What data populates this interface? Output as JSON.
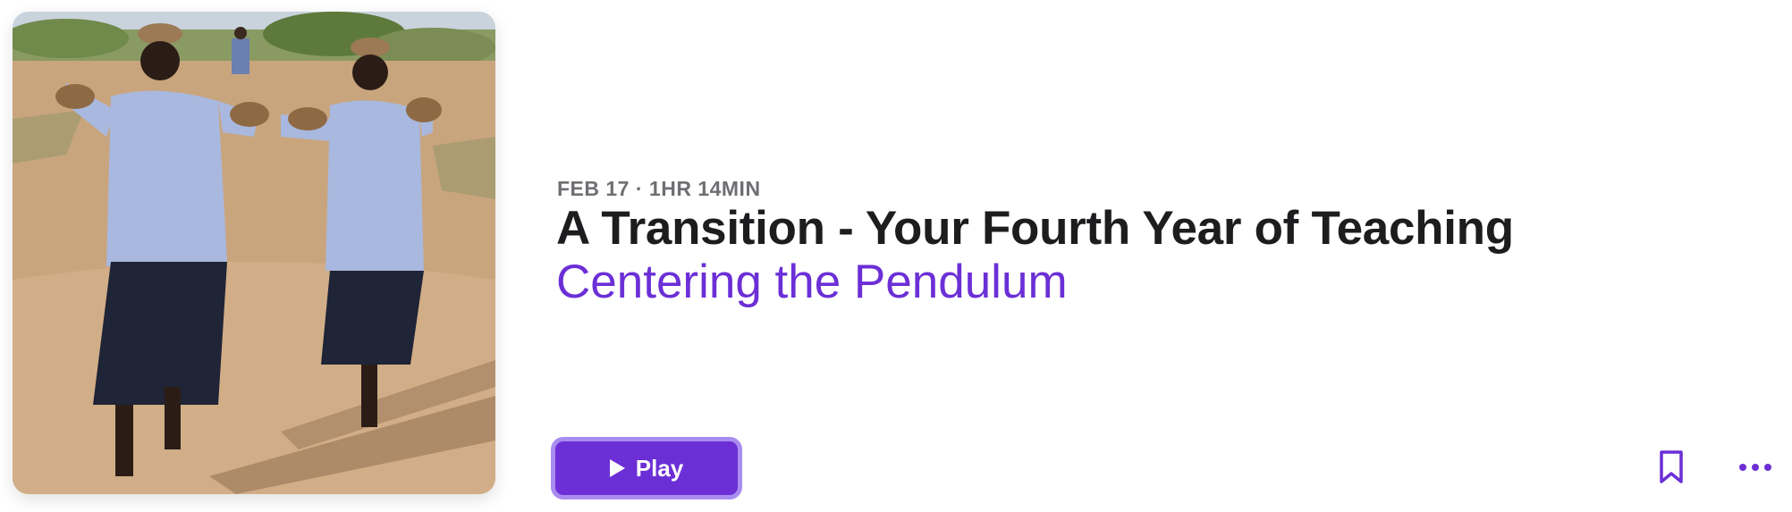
{
  "episode": {
    "meta": "FEB 17 · 1HR 14MIN",
    "title": "A Transition - Your Fourth Year of Teaching",
    "show_name": "Centering the Pendulum"
  },
  "actions": {
    "play_label": "Play"
  },
  "icons": {
    "play": "play-icon",
    "bookmark": "bookmark-icon",
    "more": "ellipsis-icon"
  },
  "colors": {
    "accent": "#6c2fd6",
    "accent_ring": "#a98cf0",
    "title": "#1d1d1f",
    "meta": "#6e6e73"
  }
}
